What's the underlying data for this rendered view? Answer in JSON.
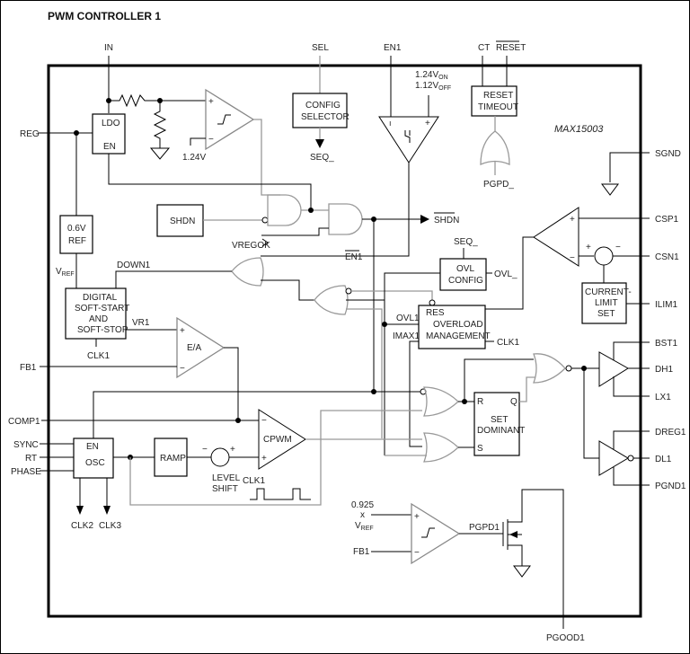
{
  "title": "PWM CONTROLLER 1",
  "part_number": "MAX15003",
  "pins": {
    "top": [
      "IN",
      "SEL",
      "EN1",
      "CT",
      "RESET"
    ],
    "left": [
      "REG",
      "FB1",
      "COMP1",
      "SYNC",
      "RT",
      "PHASE"
    ],
    "right": [
      "SGND",
      "CSP1",
      "CSN1",
      "ILIM1",
      "BST1",
      "DH1",
      "LX1",
      "DREG1",
      "DL1",
      "PGND1"
    ],
    "bottom": [
      "PGOOD1"
    ]
  },
  "blocks": {
    "ldo": {
      "top": "LDO",
      "bottom": "EN"
    },
    "config_selector": [
      "CONFIG",
      "SELECTOR"
    ],
    "reset_timeout": [
      "RESET",
      "TIMEOUT"
    ],
    "ref": [
      "0.6V",
      "REF"
    ],
    "shdn": "SHDN",
    "soft_start": [
      "DIGITAL",
      "SOFT-START",
      "AND",
      "SOFT-STOP"
    ],
    "ovl_config": [
      "OVL",
      "CONFIG"
    ],
    "overload": {
      "res": "RES",
      "lines": [
        "OVERLOAD",
        "MANAGEMENT"
      ]
    },
    "current_limit": [
      "CURRENT-",
      "LIMIT",
      "SET"
    ],
    "set_dominant": {
      "r": "R",
      "q": "Q",
      "s": "S",
      "lines": [
        "SET",
        "DOMINANT"
      ]
    },
    "osc": {
      "top": "EN",
      "bottom": "OSC"
    },
    "ramp": "RAMP"
  },
  "amplifiers": {
    "ea": "E/A",
    "cpwm": "CPWM"
  },
  "signals": {
    "v124": "1.24V",
    "en1_on": "1.24V",
    "en1_on_sub": "ON",
    "en1_off": "1.12V",
    "en1_off_sub": "OFF",
    "seq_out": "SEQ_",
    "pgpd_": "PGPD_",
    "vregok": "VREGOK",
    "shdn_out": "SHDN",
    "en1_bar": "EN1",
    "vref": "V",
    "vref_sub": "REF",
    "down1": "DOWN1",
    "vr1": "VR1",
    "clk1_ss": "CLK1",
    "seq_in": "SEQ_",
    "ovl_out": "OVL_",
    "ovl1": "OVL1",
    "imax1": "IMAX1",
    "clk1_ovl": "CLK1",
    "clk1_wave": "CLK1",
    "level_shift": [
      "LEVEL",
      "SHIFT"
    ],
    "clk2": "CLK2",
    "clk3": "CLK3",
    "pg_ref": [
      "0.925",
      "x"
    ],
    "pg_vref": "V",
    "pg_vref_sub": "REF",
    "pg_fb1": "FB1",
    "pgpd1": "PGPD1",
    "plus": "+",
    "minus": "−"
  }
}
